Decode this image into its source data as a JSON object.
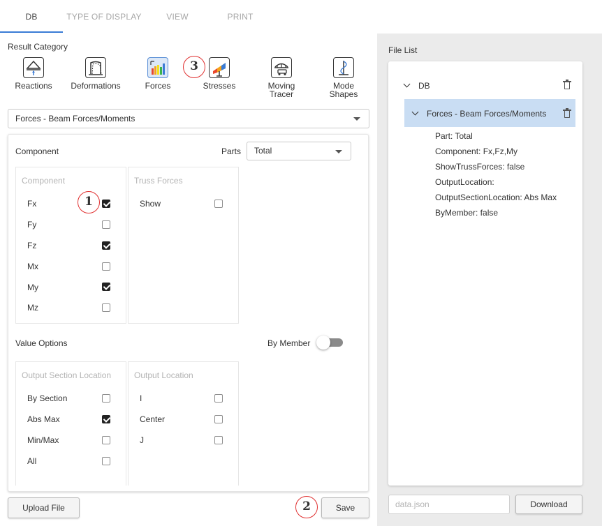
{
  "tabs": [
    {
      "label": "DB",
      "active": true
    },
    {
      "label": "TYPE OF DISPLAY",
      "active": false
    },
    {
      "label": "VIEW",
      "active": false
    },
    {
      "label": "PRINT",
      "active": false
    }
  ],
  "result_category": {
    "title": "Result Category",
    "items": [
      {
        "label": "Reactions",
        "icon": "reactions-icon"
      },
      {
        "label": "Deformations",
        "icon": "deformations-icon"
      },
      {
        "label": "Forces",
        "icon": "forces-icon",
        "selected": true
      },
      {
        "label": "Stresses",
        "icon": "stresses-icon"
      },
      {
        "label": "Moving\nTracer",
        "icon": "moving-tracer-icon"
      },
      {
        "label": "Mode\nShapes",
        "icon": "mode-shapes-icon"
      }
    ]
  },
  "result_type_select": {
    "value": "Forces - Beam Forces/Moments"
  },
  "component_section": {
    "title": "Component",
    "parts_label": "Parts",
    "parts_value": "Total",
    "component_group": {
      "title": "Component",
      "rows": [
        {
          "label": "Fx",
          "checked": true
        },
        {
          "label": "Fy",
          "checked": false
        },
        {
          "label": "Fz",
          "checked": true
        },
        {
          "label": "Mx",
          "checked": false
        },
        {
          "label": "My",
          "checked": true
        },
        {
          "label": "Mz",
          "checked": false
        }
      ]
    },
    "truss_group": {
      "title": "Truss Forces",
      "rows": [
        {
          "label": "Show",
          "checked": false
        }
      ]
    }
  },
  "value_options": {
    "title": "Value Options",
    "by_member_label": "By Member",
    "by_member_on": false,
    "output_section_group": {
      "title": "Output Section Location",
      "rows": [
        {
          "label": "By Section",
          "checked": false
        },
        {
          "label": "Abs Max",
          "checked": true
        },
        {
          "label": "Min/Max",
          "checked": false
        },
        {
          "label": "All",
          "checked": false
        }
      ]
    },
    "output_location_group": {
      "title": "Output Location",
      "rows": [
        {
          "label": "I",
          "checked": false
        },
        {
          "label": "Center",
          "checked": false
        },
        {
          "label": "J",
          "checked": false
        }
      ]
    }
  },
  "buttons": {
    "upload": "Upload File",
    "save": "Save",
    "download": "Download"
  },
  "badges": [
    "1",
    "2",
    "3"
  ],
  "file_list": {
    "title": "File List",
    "root": "DB",
    "entry": "Forces - Beam Forces/Moments",
    "details": [
      "Part: Total",
      "Component: Fx,Fz,My",
      "ShowTrussForces: false",
      "OutputLocation:",
      "OutputSectionLocation: Abs Max",
      "ByMember: false"
    ]
  },
  "filename_input": {
    "placeholder": "data.json",
    "value": ""
  },
  "colors": {
    "accent": "#3a7bd5",
    "selected_row": "#c9ddf3",
    "badge_ring": "#e03030",
    "panel_bg": "#ebebeb"
  }
}
